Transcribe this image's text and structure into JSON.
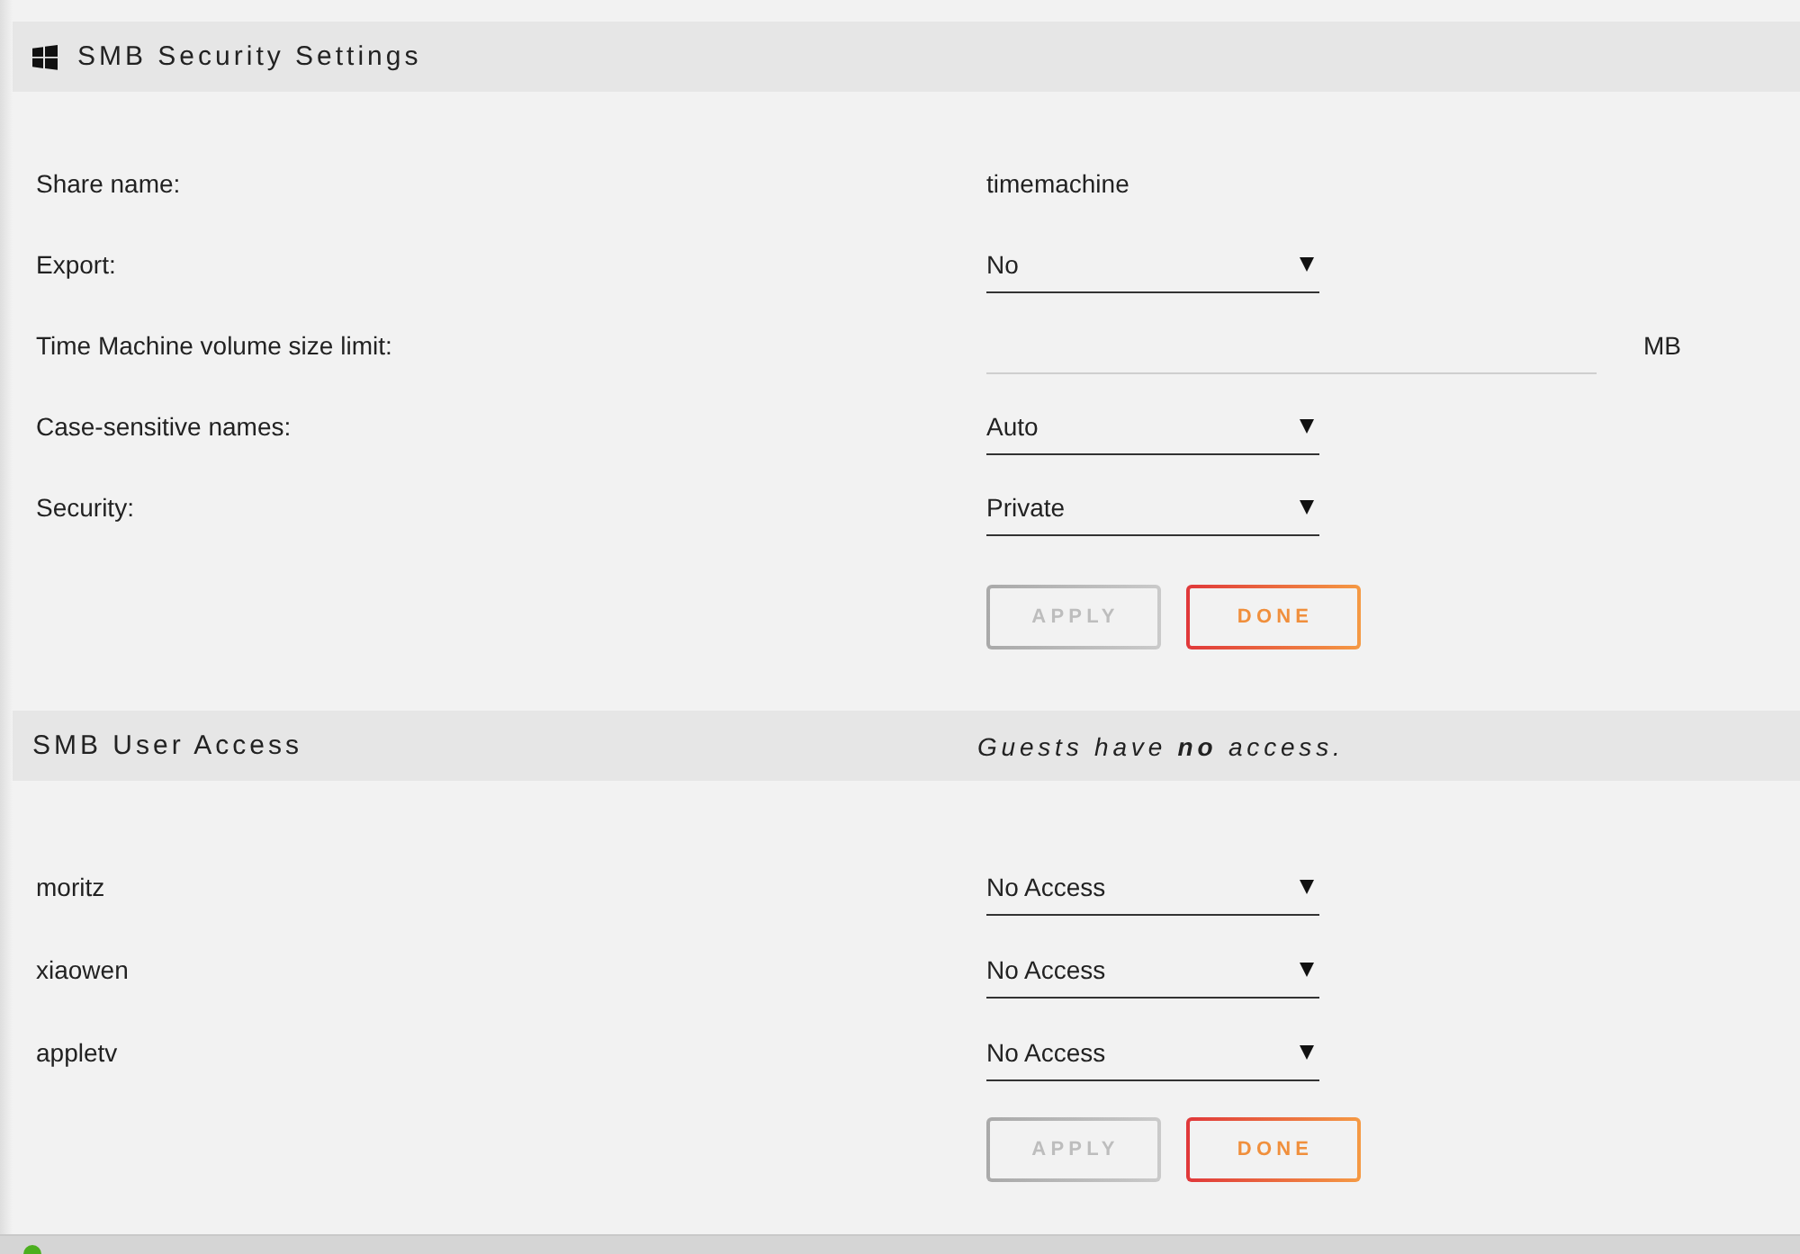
{
  "security_header": {
    "title": "SMB Security Settings"
  },
  "settings": [
    {
      "kind": "text",
      "label": "Share name:",
      "value": "timemachine"
    },
    {
      "kind": "select",
      "label": "Export:",
      "value": "No"
    },
    {
      "kind": "input",
      "label": "Time Machine volume size limit:",
      "unit": "MB"
    },
    {
      "kind": "select",
      "label": "Case-sensitive names:",
      "value": "Auto"
    },
    {
      "kind": "select",
      "label": "Security:",
      "value": "Private"
    }
  ],
  "settings_buttons": [
    {
      "label": "APPLY",
      "disabled": true
    },
    {
      "label": "DONE",
      "disabled": false
    }
  ],
  "access_header": {
    "title": "SMB User Access",
    "note": "Guests have **no** access."
  },
  "users": [
    {
      "name": "moritz",
      "access": "No Access"
    },
    {
      "name": "xiaowen",
      "access": "No Access"
    },
    {
      "name": "appletv",
      "access": "No Access"
    }
  ],
  "user_buttons": [
    {
      "label": "APPLY",
      "disabled": true
    },
    {
      "label": "DONE",
      "disabled": false
    }
  ]
}
